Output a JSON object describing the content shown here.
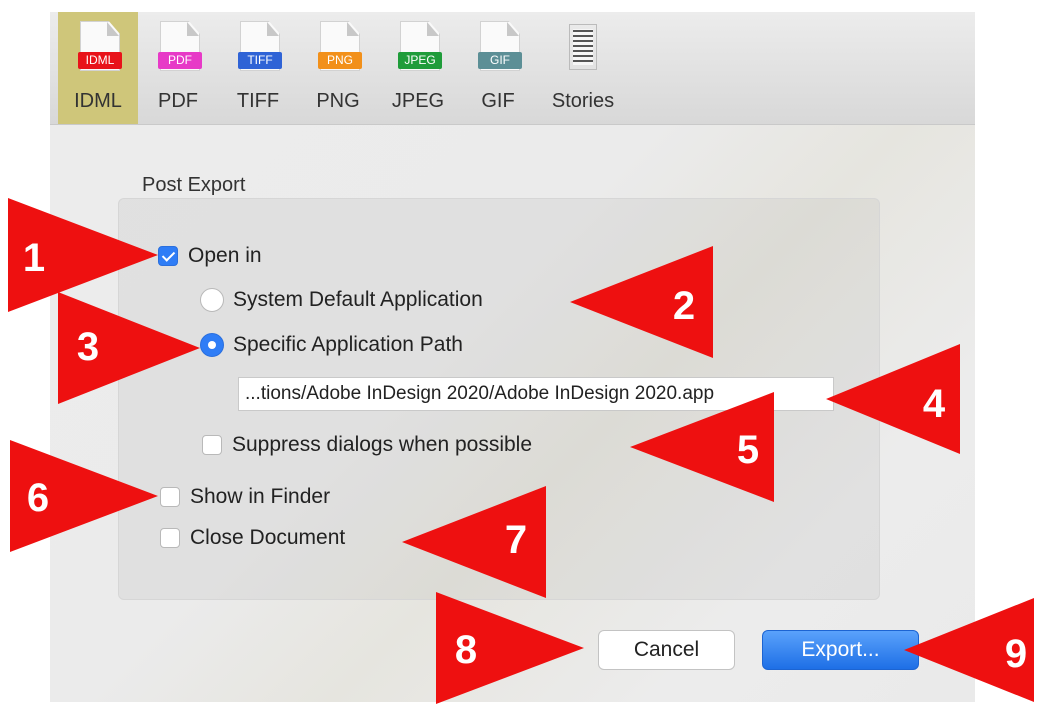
{
  "tabs": [
    {
      "label": "IDML",
      "badge": "IDML",
      "badge_color": "#e8131a",
      "active": true
    },
    {
      "label": "PDF",
      "badge": "PDF",
      "badge_color": "#e73ac7"
    },
    {
      "label": "TIFF",
      "badge": "TIFF",
      "badge_color": "#2f63d6"
    },
    {
      "label": "PNG",
      "badge": "PNG",
      "badge_color": "#f2901a"
    },
    {
      "label": "JPEG",
      "badge": "JPEG",
      "badge_color": "#1f9c3a"
    },
    {
      "label": "GIF",
      "badge": "GIF",
      "badge_color": "#5c8f96"
    },
    {
      "label": "Stories",
      "icon": "text-document-icon"
    }
  ],
  "post_export": {
    "title": "Post Export",
    "open_in": {
      "label": "Open in",
      "checked": true
    },
    "system_default": {
      "label": "System Default Application",
      "selected": false
    },
    "specific_path": {
      "label": "Specific Application Path",
      "selected": true
    },
    "app_path": "...tions/Adobe InDesign 2020/Adobe InDesign 2020.app",
    "suppress_dialogs": {
      "label": "Suppress dialogs when possible",
      "checked": false
    },
    "show_in_finder": {
      "label": "Show in Finder",
      "checked": false
    },
    "close_document": {
      "label": "Close Document",
      "checked": false
    }
  },
  "buttons": {
    "cancel": "Cancel",
    "export": "Export..."
  },
  "annotations": [
    "1",
    "2",
    "3",
    "4",
    "5",
    "6",
    "7",
    "8",
    "9"
  ],
  "colors": {
    "accent": "#2f7df6",
    "callout": "#ee1010",
    "active_tab": "#cfc67a"
  }
}
